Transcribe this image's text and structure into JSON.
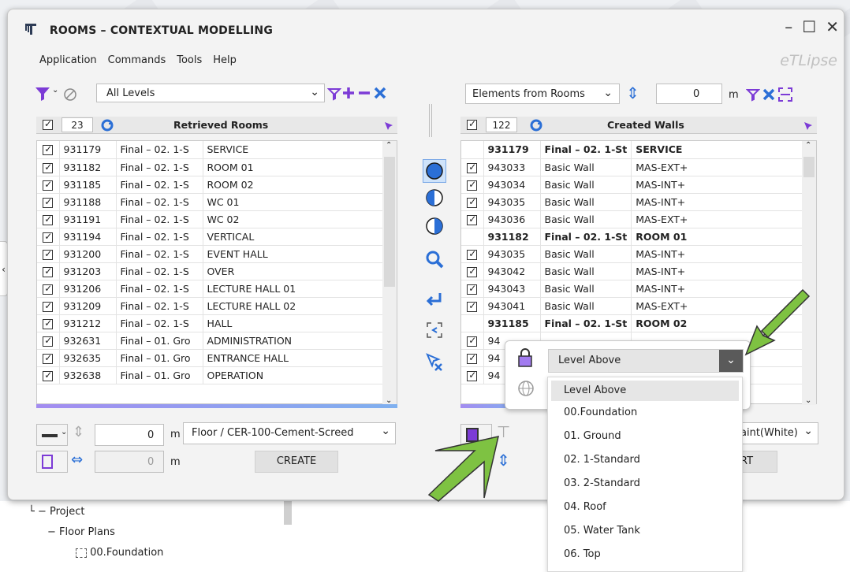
{
  "window": {
    "title": "ROOMS – CONTEXTUAL MODELLING",
    "brand": "eTLipse",
    "controls": [
      "minimize-icon",
      "maximize-icon",
      "close-icon"
    ]
  },
  "menu": [
    "Application",
    "Commands",
    "Tools",
    "Help"
  ],
  "left_panel": {
    "level_filter": "All Levels",
    "count": "23",
    "header": "Retrieved Rooms",
    "rows": [
      [
        "931179",
        "Final – 02. 1-S",
        "SERVICE"
      ],
      [
        "931182",
        "Final – 02. 1-S",
        "ROOM 01"
      ],
      [
        "931185",
        "Final – 02. 1-S",
        "ROOM 02"
      ],
      [
        "931188",
        "Final – 02. 1-S",
        "WC 01"
      ],
      [
        "931191",
        "Final – 02. 1-S",
        "WC 02"
      ],
      [
        "931194",
        "Final – 02. 1-S",
        "VERTICAL"
      ],
      [
        "931200",
        "Final – 02. 1-S",
        "EVENT HALL"
      ],
      [
        "931203",
        "Final – 02. 1-S",
        "OVER"
      ],
      [
        "931206",
        "Final – 02. 1-S",
        "LECTURE HALL 01"
      ],
      [
        "931209",
        "Final – 02. 1-S",
        "LECTURE HALL 02"
      ],
      [
        "931212",
        "Final – 02. 1-S",
        "HALL"
      ],
      [
        "932631",
        "Final – 01. Gro",
        "ADMINISTRATION"
      ],
      [
        "932635",
        "Final – 01. Gro",
        "ENTRANCE HALL"
      ],
      [
        "932638",
        "Final – 01. Gro",
        "OPERATION"
      ]
    ],
    "offset_value": "0",
    "offset_unit": "m",
    "floor_type": "Floor / CER-100-Cement-Screed",
    "offset2_value": "0",
    "offset2_unit": "m",
    "create_label": "CREATE"
  },
  "right_panel": {
    "source_select": "Elements from Rooms",
    "offset_value": "0",
    "offset_unit": "m",
    "count": "122",
    "header": "Created Walls",
    "rows": [
      {
        "group": true,
        "c1": "931179",
        "c2": "Final – 02. 1-St",
        "c3": "SERVICE"
      },
      {
        "group": false,
        "c1": "943033",
        "c2": "Basic Wall",
        "c3": "MAS-EXT+"
      },
      {
        "group": false,
        "c1": "943034",
        "c2": "Basic Wall",
        "c3": "MAS-INT+"
      },
      {
        "group": false,
        "c1": "943035",
        "c2": "Basic Wall",
        "c3": "MAS-INT+"
      },
      {
        "group": false,
        "c1": "943036",
        "c2": "Basic Wall",
        "c3": "MAS-EXT+"
      },
      {
        "group": true,
        "c1": "931182",
        "c2": "Final – 02. 1-St",
        "c3": "ROOM 01"
      },
      {
        "group": false,
        "c1": "943035",
        "c2": "Basic Wall",
        "c3": "MAS-INT+"
      },
      {
        "group": false,
        "c1": "943042",
        "c2": "Basic Wall",
        "c3": "MAS-INT+"
      },
      {
        "group": false,
        "c1": "943043",
        "c2": "Basic Wall",
        "c3": "MAS-INT+"
      },
      {
        "group": false,
        "c1": "943041",
        "c2": "Basic Wall",
        "c3": "MAS-EXT+"
      },
      {
        "group": true,
        "c1": "931185",
        "c2": "Final – 02. 1-St",
        "c3": "ROOM 02"
      },
      {
        "group": false,
        "c1": "94",
        "c2": "",
        "c3": ""
      },
      {
        "group": false,
        "c1": "94",
        "c2": "",
        "c3": ""
      },
      {
        "group": false,
        "c1": "94",
        "c2": "",
        "c3": ""
      }
    ],
    "material_partial": "aint(White)",
    "action_partial": "RT"
  },
  "dropdown": {
    "selected": "Level Above",
    "options": [
      "Level Above",
      "00.Foundation",
      "01. Ground",
      "02. 1-Standard",
      "03. 2-Standard",
      "04. Roof",
      "05. Water Tank",
      "06. Top"
    ]
  },
  "tree": {
    "project": "Project",
    "floor_plans": "Floor Plans",
    "foundation": "00.Foundation"
  },
  "colors": {
    "accent_blue": "#2b6fd6",
    "purple": "#8b5fd9",
    "arrow_green": "#7ec242"
  }
}
